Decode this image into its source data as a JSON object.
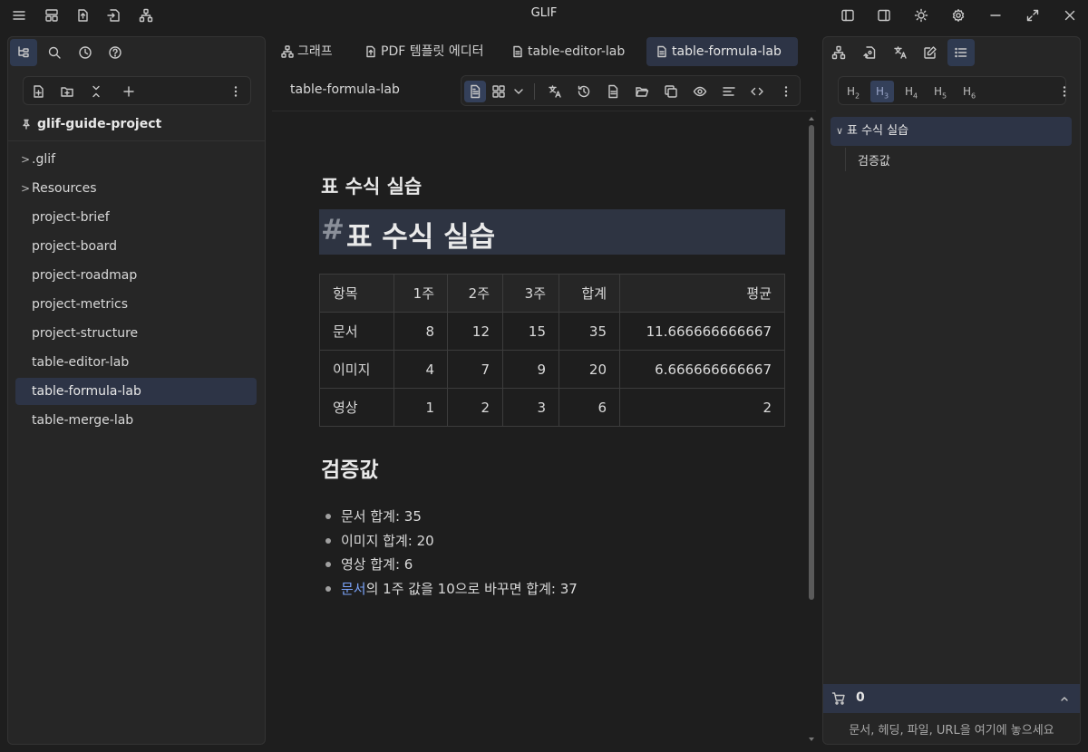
{
  "app": {
    "title": "GLIF"
  },
  "left_panel": {
    "project_name": "glif-guide-project",
    "tree": [
      {
        "label": ".glif",
        "folder": true
      },
      {
        "label": "Resources",
        "folder": true
      },
      {
        "label": "project-brief"
      },
      {
        "label": "project-board"
      },
      {
        "label": "project-roadmap"
      },
      {
        "label": "project-metrics"
      },
      {
        "label": "project-structure"
      },
      {
        "label": "table-editor-lab"
      },
      {
        "label": "table-formula-lab",
        "active": true
      },
      {
        "label": "table-merge-lab"
      }
    ]
  },
  "tabs": [
    {
      "label": "그래프"
    },
    {
      "label": "PDF 템플릿 에디터"
    },
    {
      "label": "table-editor-lab"
    },
    {
      "label": "table-formula-lab",
      "active": true
    }
  ],
  "document": {
    "header_title": "table-formula-lab",
    "heading_small": "표 수식 실습",
    "h1_hash": "#",
    "h1_text": "표 수식 실습",
    "table": {
      "headers": [
        "항목",
        "1주",
        "2주",
        "3주",
        "합계",
        "평균"
      ],
      "rows": [
        [
          "문서",
          "8",
          "12",
          "15",
          "35",
          "11.666666666667"
        ],
        [
          "이미지",
          "4",
          "7",
          "9",
          "20",
          "6.666666666667"
        ],
        [
          "영상",
          "1",
          "2",
          "3",
          "6",
          "2"
        ]
      ]
    },
    "verify_heading": "검증값",
    "verify_items": [
      "문서 합계: 35",
      "이미지 합계: 20",
      "영상 합계: 6"
    ],
    "verify_last": {
      "link": "문서",
      "rest": "의 1주 값을 10으로 바꾸면 합계: 37"
    }
  },
  "right_panel": {
    "heading_filters": [
      {
        "label": "H",
        "level": "2"
      },
      {
        "label": "H",
        "level": "3",
        "active": true
      },
      {
        "label": "H",
        "level": "4"
      },
      {
        "label": "H",
        "level": "5"
      },
      {
        "label": "H",
        "level": "6"
      }
    ],
    "outline": [
      {
        "label": "표 수식 실습"
      },
      {
        "label": "검증값"
      }
    ],
    "dropzone_count": "0",
    "dropzone_text": "문서, 헤딩, 파일, URL을 여기에 놓으세요"
  },
  "colors": {
    "background": "#1e1e1e",
    "panel": "#262626",
    "active_item": "#2d3446",
    "link": "#7aa2f7"
  }
}
